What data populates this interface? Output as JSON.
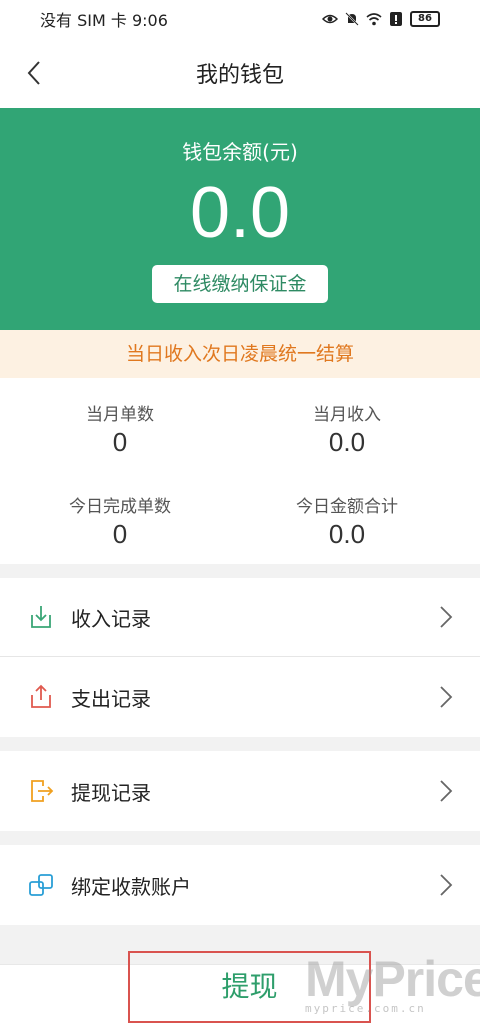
{
  "status_bar": {
    "carrier_time": "没有 SIM 卡 9:06",
    "battery": "86"
  },
  "header": {
    "title": "我的钱包"
  },
  "balance": {
    "label": "钱包余额(元)",
    "value": "0.0",
    "deposit_button": "在线缴纳保证金"
  },
  "notice": "当日收入次日凌晨统一结算",
  "stats": [
    {
      "label": "当月单数",
      "value": "0"
    },
    {
      "label": "当月收入",
      "value": "0.0"
    },
    {
      "label": "今日完成单数",
      "value": "0"
    },
    {
      "label": "今日金额合计",
      "value": "0.0"
    }
  ],
  "menu": [
    {
      "label": "收入记录",
      "icon": "income-download-icon",
      "color": "#3aa676"
    },
    {
      "label": "支出记录",
      "icon": "expense-upload-icon",
      "color": "#e05a4f"
    },
    {
      "label": "提现记录",
      "icon": "withdraw-exit-icon",
      "color": "#f0a020"
    },
    {
      "label": "绑定收款账户",
      "icon": "bind-account-link-icon",
      "color": "#2a9fd6"
    }
  ],
  "footer": {
    "withdraw_button": "提现"
  },
  "watermark": {
    "text": "MyPrice",
    "sub": "myprice.com.cn"
  },
  "colors": {
    "primary": "#31a575",
    "notice_bg": "#fdf1e2",
    "notice_text": "#e0781f"
  }
}
